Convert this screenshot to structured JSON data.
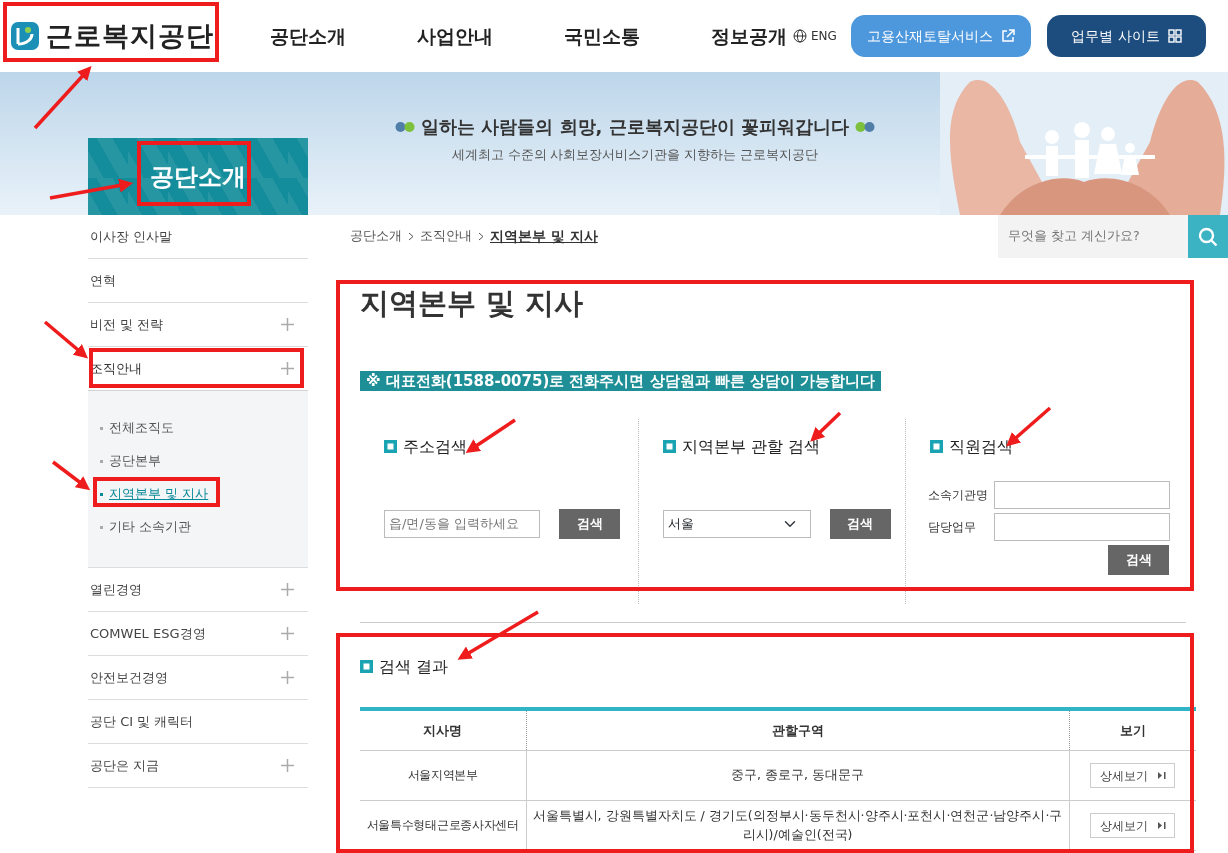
{
  "header": {
    "logo": "근로복지공단",
    "nav": [
      "공단소개",
      "사업안내",
      "국민소통",
      "정보공개"
    ],
    "language": "ENG",
    "buttons": [
      {
        "label": "고용산재토탈서비스",
        "kind": "external"
      },
      {
        "label": "업무별 사이트",
        "kind": "grid"
      }
    ]
  },
  "banner": {
    "section_title": "공단소개",
    "headline": "일하는 사람들의 희망, 근로복지공단이 꽃피워갑니다",
    "subtitle": "세계최고 수준의 사회보장서비스기관을 지향하는 근로복지공단"
  },
  "sidebar": {
    "items": [
      {
        "label": "이사장 인사말",
        "has_submenu": false
      },
      {
        "label": "연혁",
        "has_submenu": false
      },
      {
        "label": "비전 및 전략",
        "has_submenu": true,
        "expanded": false
      },
      {
        "label": "조직안내",
        "has_submenu": true,
        "expanded": true,
        "children": [
          {
            "label": "전체조직도",
            "selected": false
          },
          {
            "label": "공단본부",
            "selected": false
          },
          {
            "label": "지역본부 및 지사",
            "selected": true
          },
          {
            "label": "기타 소속기관",
            "selected": false
          }
        ]
      },
      {
        "label": "열린경영",
        "has_submenu": true,
        "expanded": false
      },
      {
        "label": "COMWEL ESG경영",
        "has_submenu": true,
        "expanded": false
      },
      {
        "label": "안전보건경영",
        "has_submenu": true,
        "expanded": false
      },
      {
        "label": "공단 CI 및 캐릭터",
        "has_submenu": false
      },
      {
        "label": "공단은 지금",
        "has_submenu": true,
        "expanded": false
      }
    ]
  },
  "breadcrumb": [
    "공단소개",
    "조직안내",
    "지역본부 및 지사"
  ],
  "site_search": {
    "placeholder": "무엇을 찾고 계신가요?"
  },
  "page_title": "지역본부 및 지사",
  "notice": "※ 대표전화(1588-0075)로 전화주시면 상담원과 빠른 상담이 가능합니다",
  "search_panels": [
    {
      "kind": "address",
      "title": "주소검색",
      "placeholder": "읍/면/동을 입력하세요",
      "button": "검색"
    },
    {
      "kind": "region",
      "title": "지역본부 관할 검색",
      "value": "서울",
      "button": "검색"
    },
    {
      "kind": "staff",
      "title": "직원검색",
      "fields": [
        "소속기관명",
        "담당업무"
      ],
      "button": "검색"
    }
  ],
  "results": {
    "title": "검색 결과",
    "columns": [
      "지사명",
      "관할구역",
      "보기"
    ],
    "rows": [
      {
        "name": "서울지역본부",
        "area": "중구, 종로구, 동대문구",
        "action": "상세보기"
      },
      {
        "name": "서울특수형태근로종사자센터",
        "area": "서울특별시, 강원특별자치도 / 경기도(의정부시·동두천시·양주시·포천시·연천군·남양주시·구리시)/예술인(전국)",
        "action": "상세보기"
      }
    ]
  }
}
